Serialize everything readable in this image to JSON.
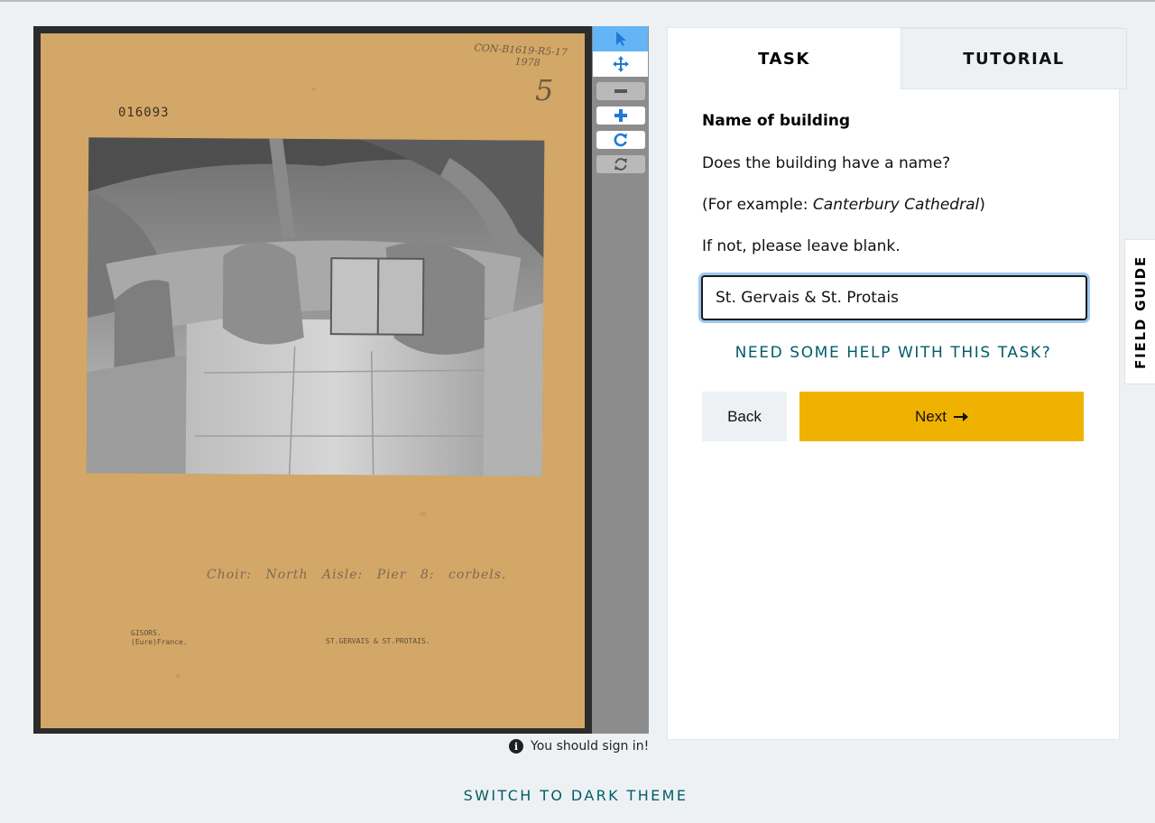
{
  "subject": {
    "card": {
      "id_number": "016093",
      "reference_line1": "CON-B1619-R5-17",
      "reference_line2": "1978",
      "sheet_number": "5",
      "caption": "Choir: North Aisle: Pier 8: corbels.",
      "location_line1": "GISORS.",
      "location_line2": "(Eure)France.",
      "church": "ST.GERVAIS & ST.PROTAIS."
    }
  },
  "toolbar": {
    "tools": [
      "pointer-icon",
      "move-icon",
      "zoom-out-icon",
      "zoom-in-icon",
      "rotate-icon",
      "reset-icon"
    ]
  },
  "notice": {
    "text": "You should sign in!"
  },
  "panel": {
    "tabs": {
      "task": "TASK",
      "tutorial": "TUTORIAL"
    },
    "question": {
      "title": "Name of building",
      "line1": "Does the building have a name?",
      "line2_prefix": "(For example: ",
      "line2_example": "Canterbury Cathedral",
      "line2_suffix": ")",
      "line3": "If not, please leave blank."
    },
    "answer_value": "St. Gervais & St. Protais",
    "help_link": "NEED SOME HELP WITH THIS TASK?",
    "back_label": "Back",
    "next_label": "Next"
  },
  "field_guide": {
    "label": "FIELD GUIDE"
  },
  "footer": {
    "theme_toggle": "SWITCH TO DARK THEME"
  },
  "colors": {
    "card": "#d3a767",
    "accent_link": "#005d69",
    "next_button": "#f0b200",
    "active_tool": "#64b5f6",
    "tool_icon": "#1e7ad6"
  }
}
